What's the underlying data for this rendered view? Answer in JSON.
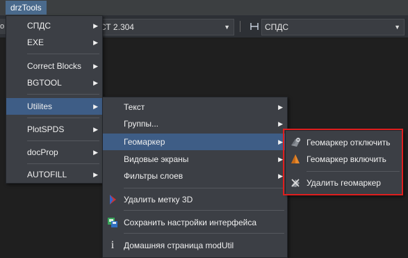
{
  "menubar": {
    "title": "drzTools"
  },
  "toolbar": {
    "left_stub": "о",
    "text_style_value": "СТ 2.304",
    "dim_style_value": "СПДС"
  },
  "main_menu": {
    "items": [
      {
        "label": "СПДС",
        "submenu": true
      },
      {
        "label": "EXE",
        "submenu": true
      },
      {
        "label": "Correct Blocks",
        "submenu": true
      },
      {
        "label": "BGTOOL",
        "submenu": true
      },
      {
        "label": "Utilites",
        "submenu": true,
        "active": true
      },
      {
        "label": "PlotSPDS",
        "submenu": true
      },
      {
        "label": "docProp",
        "submenu": true
      },
      {
        "label": "AUTOFILL",
        "submenu": true
      }
    ]
  },
  "utilites_menu": {
    "items": [
      {
        "label": "Текст",
        "submenu": true
      },
      {
        "label": "Группы...",
        "submenu": true
      },
      {
        "label": "Геомаркер",
        "submenu": true,
        "active": true
      },
      {
        "label": "Видовые экраны",
        "submenu": true
      },
      {
        "label": "Фильтры слоев",
        "submenu": true
      },
      {
        "label": "Удалить метку 3D",
        "icon": "remove-3d-mark-icon"
      },
      {
        "label": "Сохранить настройки интерфейса",
        "icon": "save-settings-icon"
      },
      {
        "label": "Домашняя страница modUtil",
        "icon": "info-icon"
      }
    ]
  },
  "geomarker_menu": {
    "items": [
      {
        "label": "Геомаркер отключить",
        "icon": "geomarker-off-icon"
      },
      {
        "label": "Геомаркер включить",
        "icon": "geomarker-on-icon"
      },
      {
        "label": "Удалить геомаркер",
        "icon": "geomarker-delete-icon"
      }
    ]
  },
  "arrow_glyph": "▶",
  "dropdown_glyph": "▼",
  "highlight_color": "#e01e1e",
  "accent_color": "#3e5d86"
}
